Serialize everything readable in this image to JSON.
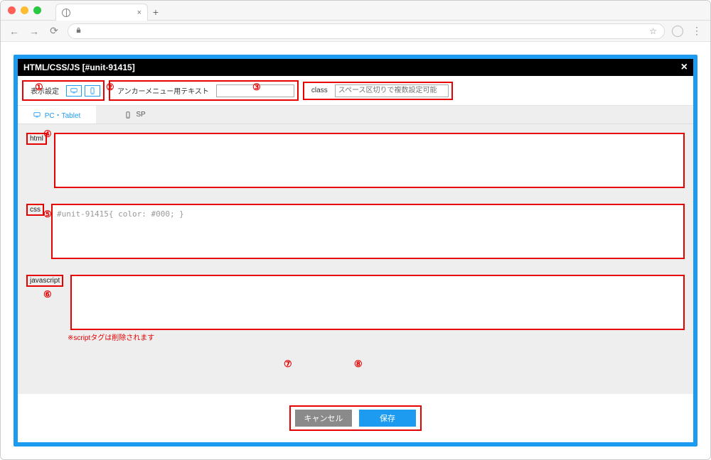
{
  "browser": {
    "tab_close": "×",
    "new_tab": "+",
    "back": "←",
    "forward": "→",
    "reload": "⟳",
    "star": "☆"
  },
  "dialog": {
    "title": "HTML/CSS/JS [#unit-91415]",
    "close": "×"
  },
  "settings": {
    "display_label": "表示設定",
    "anchor_label": "アンカーメニュー用テキスト",
    "class_label": "class",
    "class_placeholder": "スペース区切りで複数設定可能"
  },
  "tabs": {
    "pc": "PC・Tablet",
    "sp": "SP"
  },
  "code": {
    "html_label": "html",
    "css_label": "css",
    "js_label": "javascript",
    "css_value": "#unit-91415{ color: #000; }",
    "js_note": "※scriptタグは削除されます"
  },
  "buttons": {
    "cancel": "キャンセル",
    "save": "保存"
  },
  "annotations": {
    "a1": "①",
    "a2": "②",
    "a3": "③",
    "a4": "④",
    "a5": "⑤",
    "a6": "⑥",
    "a7": "⑦",
    "a8": "⑧"
  }
}
